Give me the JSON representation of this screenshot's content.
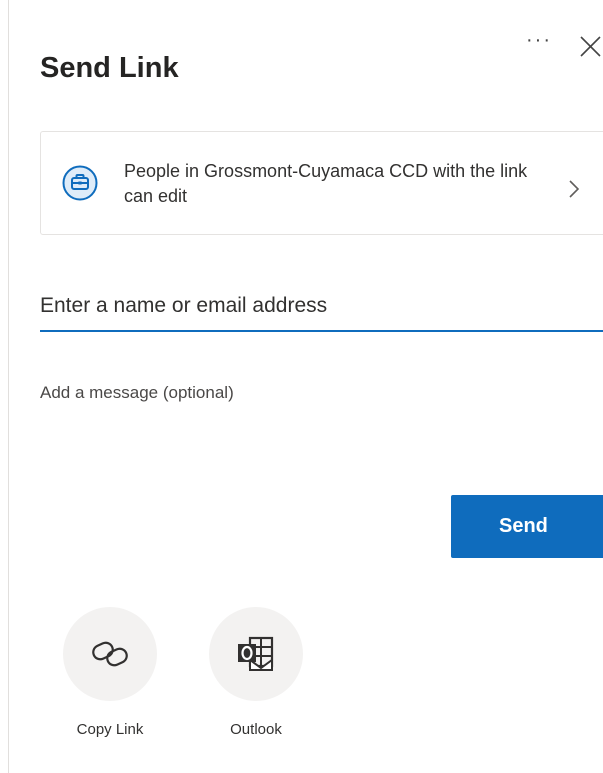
{
  "dialog": {
    "title": "Send Link",
    "more_label": "···",
    "link_settings": {
      "description": "People in Grossmont-Cuyamaca CCD with the link can edit",
      "icon": "briefcase-icon"
    },
    "recipient": {
      "placeholder": "Enter a name or email address",
      "value": ""
    },
    "message": {
      "placeholder": "Add a message (optional)",
      "value": ""
    },
    "send_label": "Send",
    "share_options": [
      {
        "label": "Copy Link",
        "icon": "link-icon"
      },
      {
        "label": "Outlook",
        "icon": "outlook-icon"
      }
    ]
  },
  "colors": {
    "accent": "#0f6cbd",
    "option_background": "#f3f2f1"
  }
}
